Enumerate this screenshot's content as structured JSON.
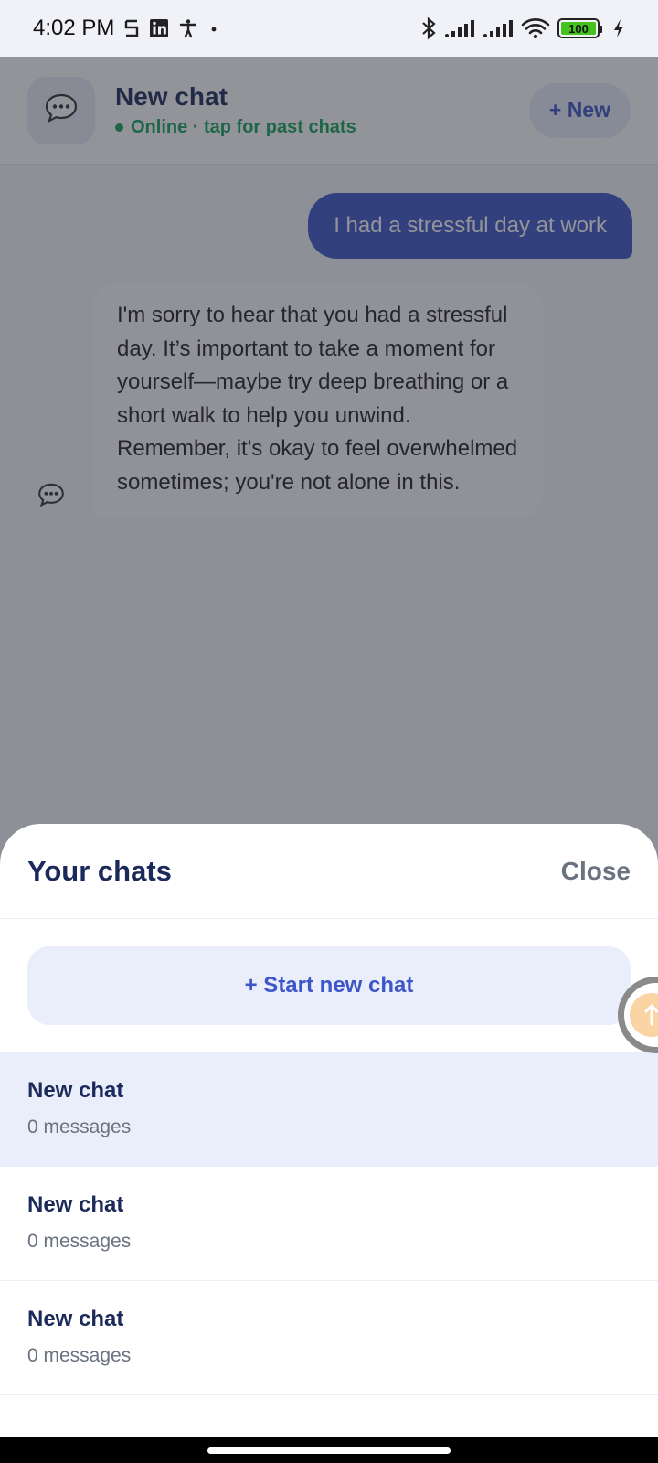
{
  "status_bar": {
    "time": "4:02 PM",
    "icons_left": [
      "sim-icon",
      "linkedin-icon",
      "accessibility-icon",
      "dot-icon"
    ],
    "icons_right": [
      "bluetooth-icon",
      "signal-icon",
      "signal-icon",
      "wifi-icon",
      "battery-icon",
      "charging-icon"
    ],
    "battery_level": "100"
  },
  "header": {
    "title": "New chat",
    "status": "Online · tap for past chats",
    "new_button": "+ New"
  },
  "messages": [
    {
      "role": "user",
      "text": "I had a stressful day at work"
    },
    {
      "role": "bot",
      "text": "I'm sorry to hear that you had a stressful day. It’s important to take a moment for yourself—maybe try deep breathing or a short walk to help you unwind. Remember, it's okay to feel overwhelmed sometimes; you're not alone in this."
    }
  ],
  "sheet": {
    "title": "Your chats",
    "close_label": "Close",
    "start_new_label": "+ Start new chat",
    "chats": [
      {
        "name": "New chat",
        "count": "0 messages",
        "active": true
      },
      {
        "name": "New chat",
        "count": "0 messages",
        "active": false
      },
      {
        "name": "New chat",
        "count": "0 messages",
        "active": false
      }
    ]
  },
  "colors": {
    "accent": "#3f56c8",
    "online": "#12a35a",
    "title": "#1b2a5a"
  }
}
